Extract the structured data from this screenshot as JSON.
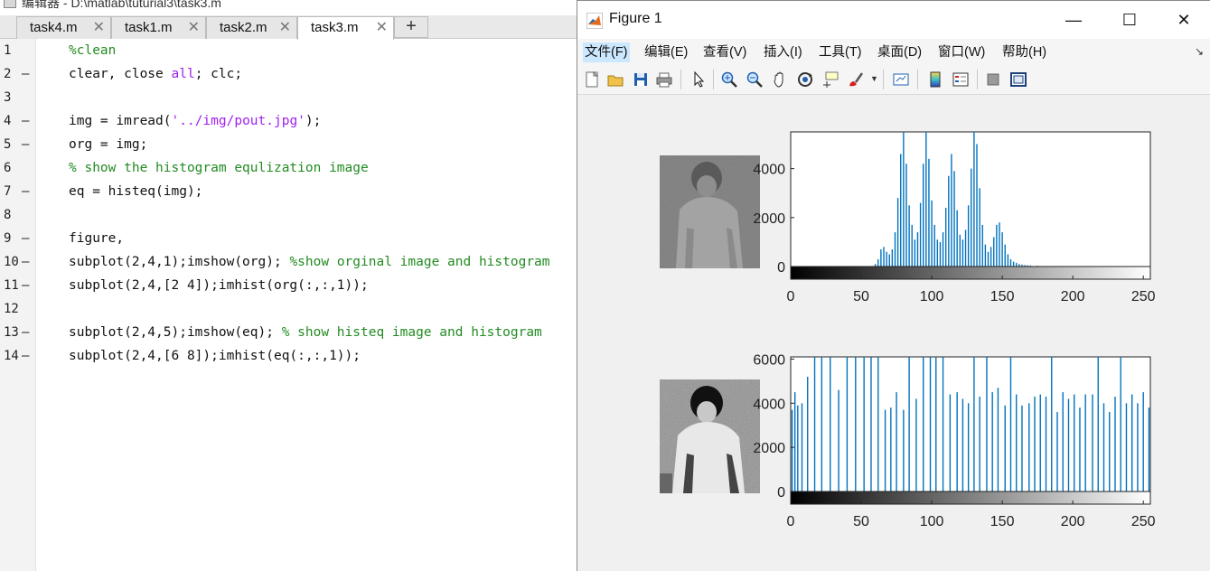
{
  "editor": {
    "title": "编辑器 - D:\\matlab\\tuturial3\\task3.m",
    "tabs": [
      {
        "label": "task4.m",
        "close": "✕"
      },
      {
        "label": "task1.m",
        "close": "✕"
      },
      {
        "label": "task2.m",
        "close": "✕"
      },
      {
        "label": "task3.m",
        "close": "✕"
      }
    ],
    "add_tab": "+",
    "lines": [
      {
        "num": "1",
        "dash": ""
      },
      {
        "num": "2",
        "dash": "—"
      },
      {
        "num": "3",
        "dash": ""
      },
      {
        "num": "4",
        "dash": "—"
      },
      {
        "num": "5",
        "dash": "—"
      },
      {
        "num": "6",
        "dash": ""
      },
      {
        "num": "7",
        "dash": "—"
      },
      {
        "num": "8",
        "dash": ""
      },
      {
        "num": "9",
        "dash": "—"
      },
      {
        "num": "10",
        "dash": "—"
      },
      {
        "num": "11",
        "dash": "—"
      },
      {
        "num": "12",
        "dash": ""
      },
      {
        "num": "13",
        "dash": "—"
      },
      {
        "num": "14",
        "dash": "—"
      }
    ],
    "code": {
      "l1": "%clean",
      "l2a": "clear, close ",
      "l2b": "all",
      "l2c": "; clc;",
      "l4a": "img = imread(",
      "l4b": "'../img/pout.jpg'",
      "l4c": ");",
      "l5": "org = img;",
      "l6": "% show the histogram equlization image",
      "l7": "eq = histeq(img);",
      "l9": "figure,",
      "l10a": "subplot(2,4,1);imshow(org); ",
      "l10b": "%show orginal image and histogram",
      "l11": "subplot(2,4,[2 4]);imhist(org(:,:,1));",
      "l13a": "subplot(2,4,5);imshow(eq); ",
      "l13b": "% show histeq image and histogram",
      "l14": "subplot(2,4,[6 8]);imhist(eq(:,:,1));"
    }
  },
  "figure": {
    "title": "Figure 1",
    "window_buttons": {
      "minimize": "—",
      "maximize": "☐",
      "close": "✕"
    },
    "menus": [
      "文件(F)",
      "编辑(E)",
      "查看(V)",
      "插入(I)",
      "工具(T)",
      "桌面(D)",
      "窗口(W)",
      "帮助(H)"
    ],
    "toolbar_icons": [
      "new-figure-icon",
      "open-icon",
      "save-icon",
      "print-icon",
      "pointer-icon",
      "zoom-in-icon",
      "zoom-out-icon",
      "pan-icon",
      "rotate-icon",
      "data-cursor-icon",
      "brush-icon",
      "link-icon",
      "colorbar-icon",
      "legend-icon",
      "hide-plot-tools-icon",
      "show-plot-tools-icon"
    ],
    "colors": {
      "bar": "#0072bd",
      "axis": "#222222",
      "accent": "#cce8ff"
    }
  },
  "chart_data": [
    {
      "type": "bar",
      "title": "",
      "xlabel": "",
      "ylabel": "",
      "xlim": [
        0,
        255
      ],
      "ylim": [
        0,
        5500
      ],
      "xticks": [
        "0",
        "50",
        "100",
        "150",
        "200",
        "250"
      ],
      "yticks": [
        "0",
        "2000",
        "4000"
      ],
      "grid": false,
      "x": [
        60,
        62,
        64,
        66,
        68,
        70,
        72,
        74,
        76,
        78,
        80,
        82,
        84,
        86,
        88,
        90,
        92,
        94,
        96,
        98,
        100,
        102,
        104,
        106,
        108,
        110,
        112,
        114,
        116,
        118,
        120,
        122,
        124,
        126,
        128,
        130,
        132,
        134,
        136,
        138,
        140,
        142,
        144,
        146,
        148,
        150,
        152,
        154,
        156,
        158,
        160,
        162,
        164,
        166,
        168,
        170,
        175,
        180
      ],
      "values": [
        100,
        300,
        700,
        800,
        600,
        500,
        700,
        1400,
        2800,
        4600,
        5500,
        4200,
        2500,
        1700,
        1100,
        1400,
        2600,
        4200,
        5500,
        4400,
        2700,
        1700,
        1100,
        1000,
        1400,
        2400,
        3700,
        4600,
        3900,
        2300,
        1300,
        1100,
        1500,
        2500,
        4000,
        5500,
        5000,
        3200,
        1700,
        900,
        600,
        800,
        1200,
        1700,
        1800,
        1400,
        900,
        500,
        300,
        200,
        150,
        100,
        80,
        60,
        50,
        40,
        30,
        20
      ]
    },
    {
      "type": "bar",
      "title": "",
      "xlabel": "",
      "ylabel": "",
      "xlim": [
        0,
        255
      ],
      "ylim": [
        0,
        6100
      ],
      "xticks": [
        "0",
        "50",
        "100",
        "150",
        "200",
        "250"
      ],
      "yticks": [
        "0",
        "2000",
        "4000",
        "6000"
      ],
      "grid": false,
      "x": [
        1,
        3,
        5,
        8,
        12,
        17,
        22,
        28,
        34,
        40,
        46,
        52,
        57,
        62,
        67,
        71,
        75,
        80,
        84,
        89,
        94,
        99,
        103,
        108,
        113,
        118,
        122,
        126,
        130,
        134,
        139,
        143,
        147,
        152,
        156,
        160,
        164,
        169,
        173,
        177,
        181,
        185,
        189,
        193,
        197,
        201,
        205,
        209,
        214,
        218,
        222,
        226,
        230,
        234,
        238,
        242,
        246,
        250,
        254
      ],
      "values": [
        3700,
        4500,
        3900,
        4000,
        5200,
        6100,
        6100,
        6100,
        4600,
        6100,
        6100,
        6100,
        6100,
        6100,
        3700,
        3800,
        4500,
        3700,
        6100,
        4200,
        6100,
        6100,
        6100,
        6100,
        4400,
        4500,
        4200,
        4000,
        6100,
        4300,
        6100,
        4500,
        4700,
        3900,
        6100,
        4400,
        3900,
        4000,
        4300,
        4400,
        4300,
        6100,
        3600,
        4500,
        4200,
        4400,
        3800,
        4400,
        4400,
        6100,
        4000,
        3600,
        4300,
        6100,
        4000,
        4400,
        4000,
        4500,
        3800
      ]
    }
  ]
}
